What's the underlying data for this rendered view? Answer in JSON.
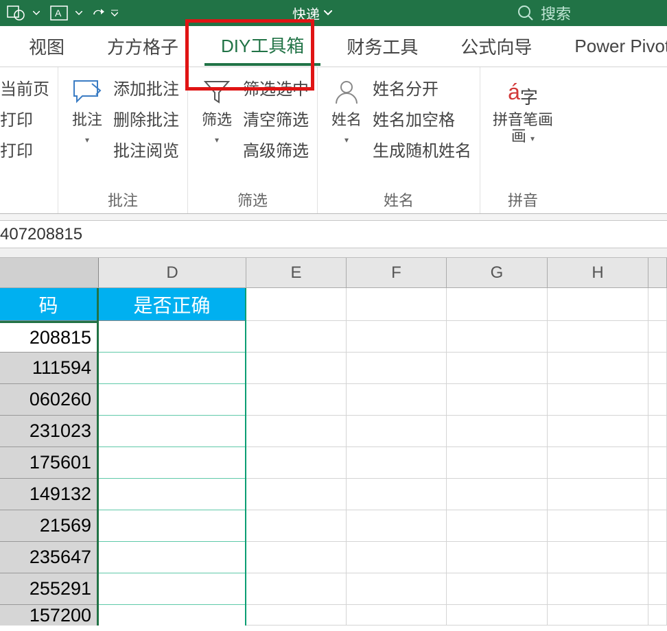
{
  "title_bar": {
    "doc_label": "快递"
  },
  "search": {
    "placeholder": "搜索"
  },
  "ribbon_tabs": [
    "视图",
    "方方格子",
    "DIY工具箱",
    "财务工具",
    "公式向导",
    "Power Pivot"
  ],
  "active_tab_index": 2,
  "ribbon_groups": {
    "print": {
      "items": [
        "当前页",
        "打印",
        "打印"
      ]
    },
    "comments": {
      "big_label": "批注",
      "items": [
        "添加批注",
        "删除批注",
        "批注阅览"
      ],
      "group_label": "批注"
    },
    "filter": {
      "big_label": "筛选",
      "items": [
        "筛选选中",
        "清空筛选",
        "高级筛选"
      ],
      "group_label": "筛选"
    },
    "name": {
      "big_label": "姓名",
      "items": [
        "姓名分开",
        "姓名加空格",
        "生成随机姓名"
      ],
      "group_label": "姓名"
    },
    "pinyin": {
      "big_label": "拼音笔画",
      "group_label": "拼音"
    }
  },
  "formula_bar_value": "407208815",
  "columns": [
    "D",
    "E",
    "F",
    "G",
    "H"
  ],
  "table": {
    "header_c": "码",
    "header_d": "是否正确",
    "rows_c": [
      "208815",
      "111594",
      "060260",
      "231023",
      "175601",
      "149132",
      "21569",
      "235647",
      "255291",
      "157200"
    ]
  }
}
